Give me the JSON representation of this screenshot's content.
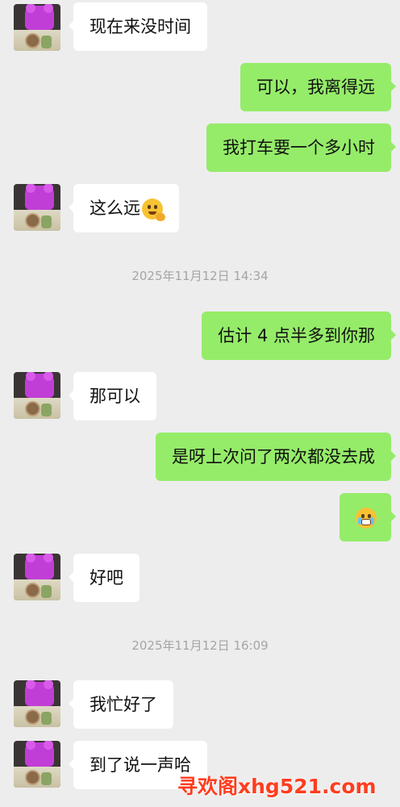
{
  "messages": [
    {
      "side": "left",
      "text": "现在来没时间"
    },
    {
      "side": "right",
      "text": "可以，我离得远"
    },
    {
      "side": "right",
      "text": "我打车要一个多小时"
    },
    {
      "side": "left",
      "text": "这么远",
      "emoji": "thinking-face-icon"
    },
    {
      "timestamp": "2025年11月12日 14:34"
    },
    {
      "side": "right",
      "text": "估计 4 点半多到你那"
    },
    {
      "side": "left",
      "text": "那可以"
    },
    {
      "side": "right",
      "text": "是呀上次问了两次都没去成"
    },
    {
      "side": "right",
      "text": "",
      "emoji": "crying-face-icon"
    },
    {
      "side": "left",
      "text": "好吧"
    },
    {
      "timestamp": "2025年11月12日 16:09"
    },
    {
      "side": "left",
      "text": "我忙好了"
    },
    {
      "side": "left",
      "text": "到了说一声哈"
    }
  ],
  "watermark": "寻欢阁xhg521.com",
  "colors": {
    "background": "#ededed",
    "sent_bubble": "#95ec69",
    "received_bubble": "#ffffff",
    "timestamp": "#a5a5a5",
    "watermark": "#ff3d1f"
  }
}
